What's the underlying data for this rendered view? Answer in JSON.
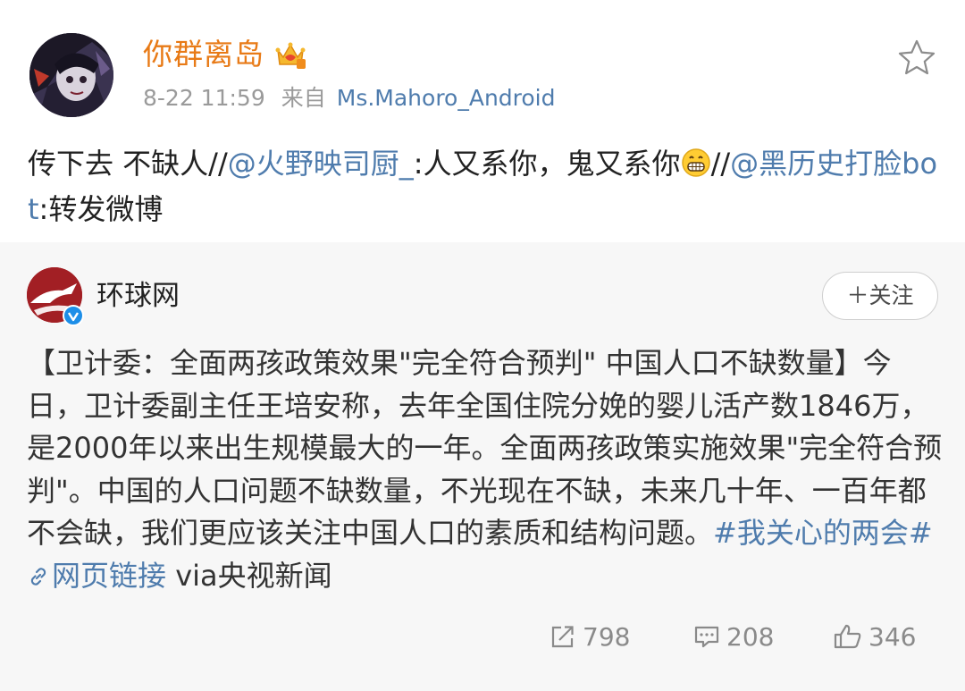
{
  "post": {
    "user_name": "你群离岛",
    "time": "8-22 11:59",
    "from_label": "来自",
    "source": "Ms.Mahoro_Android",
    "text": {
      "part1": "传下去 不缺人//",
      "mention1": "@火野映司厨_",
      "part2": ":人又系你，鬼又系你",
      "part3": "//",
      "mention2": "@黑历史打脸bot",
      "part4": ":转发微博"
    },
    "icons": {
      "vip": "crown-badge-icon",
      "favorite": "star-icon",
      "emoji": "grin-emoji-icon"
    }
  },
  "retweet": {
    "author": "环球网",
    "follow_label": "＋关注",
    "text": {
      "body": "【卫计委：全面两孩政策效果\"完全符合预判\" 中国人口不缺数量】今日，卫计委副主任王培安称，去年全国住院分娩的婴儿活产数1846万，是2000年以来出生规模最大的一年。全面两孩政策实施效果\"完全符合预判\"。中国的人口问题不缺数量，不光现在不缺，未来几十年、一百年都不会缺，我们更应该关注中国人口的素质和结构问题。",
      "topic": "#我关心的两会#",
      "link": "网页链接",
      "via": " via央视新闻"
    },
    "counts": {
      "reposts": "798",
      "comments": "208",
      "likes": "346"
    }
  },
  "colors": {
    "accent_name": "#e87a16",
    "link": "#4f7cad",
    "retweet_bg": "#f7f7f7",
    "muted": "#9a9a9a"
  }
}
